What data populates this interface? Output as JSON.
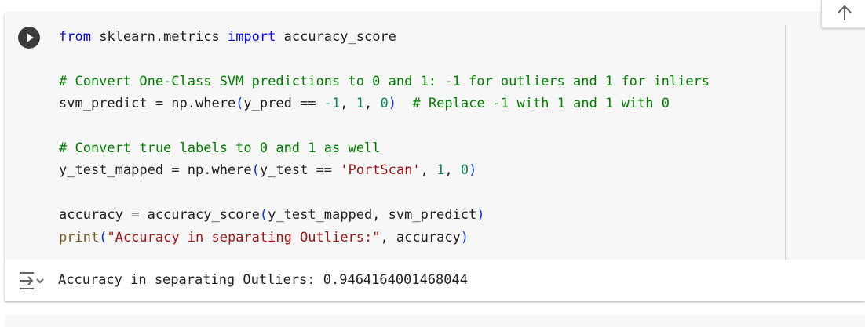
{
  "cell": {
    "run_button_icon": "play-circle-icon",
    "code_lines": [
      [
        {
          "t": "from",
          "c": "kw"
        },
        {
          "t": " sklearn.metrics ",
          "c": ""
        },
        {
          "t": "import",
          "c": "kw"
        },
        {
          "t": " accuracy_score",
          "c": ""
        }
      ],
      [],
      [
        {
          "t": "# Convert One-Class SVM predictions to 0 and 1: -1 for outliers and 1 for inliers",
          "c": "cm"
        }
      ],
      [
        {
          "t": "svm_predict = np.where",
          "c": ""
        },
        {
          "t": "(",
          "c": "pa"
        },
        {
          "t": "y_pred == ",
          "c": ""
        },
        {
          "t": "-1",
          "c": "nm"
        },
        {
          "t": ", ",
          "c": ""
        },
        {
          "t": "1",
          "c": "nm"
        },
        {
          "t": ", ",
          "c": ""
        },
        {
          "t": "0",
          "c": "nm"
        },
        {
          "t": ")",
          "c": "pa"
        },
        {
          "t": "  ",
          "c": ""
        },
        {
          "t": "# Replace -1 with 1 and 1 with 0",
          "c": "cm"
        }
      ],
      [],
      [
        {
          "t": "# Convert true labels to 0 and 1 as well",
          "c": "cm"
        }
      ],
      [
        {
          "t": "y_test_mapped = np.where",
          "c": ""
        },
        {
          "t": "(",
          "c": "pa"
        },
        {
          "t": "y_test == ",
          "c": ""
        },
        {
          "t": "'PortScan'",
          "c": "st"
        },
        {
          "t": ", ",
          "c": ""
        },
        {
          "t": "1",
          "c": "nm"
        },
        {
          "t": ", ",
          "c": ""
        },
        {
          "t": "0",
          "c": "nm"
        },
        {
          "t": ")",
          "c": "pa"
        }
      ],
      [],
      [
        {
          "t": "accuracy = accuracy_score",
          "c": ""
        },
        {
          "t": "(",
          "c": "pa"
        },
        {
          "t": "y_test_mapped, svm_predict",
          "c": ""
        },
        {
          "t": ")",
          "c": "pa"
        }
      ],
      [
        {
          "t": "print",
          "c": "bi"
        },
        {
          "t": "(",
          "c": "pa"
        },
        {
          "t": "\"Accuracy in separating Outliers:\"",
          "c": "st"
        },
        {
          "t": ", accuracy",
          "c": ""
        },
        {
          "t": ")",
          "c": "pa"
        }
      ]
    ]
  },
  "output": {
    "icon": "output-toggle-icon",
    "text": "Accuracy in separating Outliers: 0.9464164001468044"
  },
  "scroll_up_button": {
    "icon": "arrow-up-icon"
  }
}
